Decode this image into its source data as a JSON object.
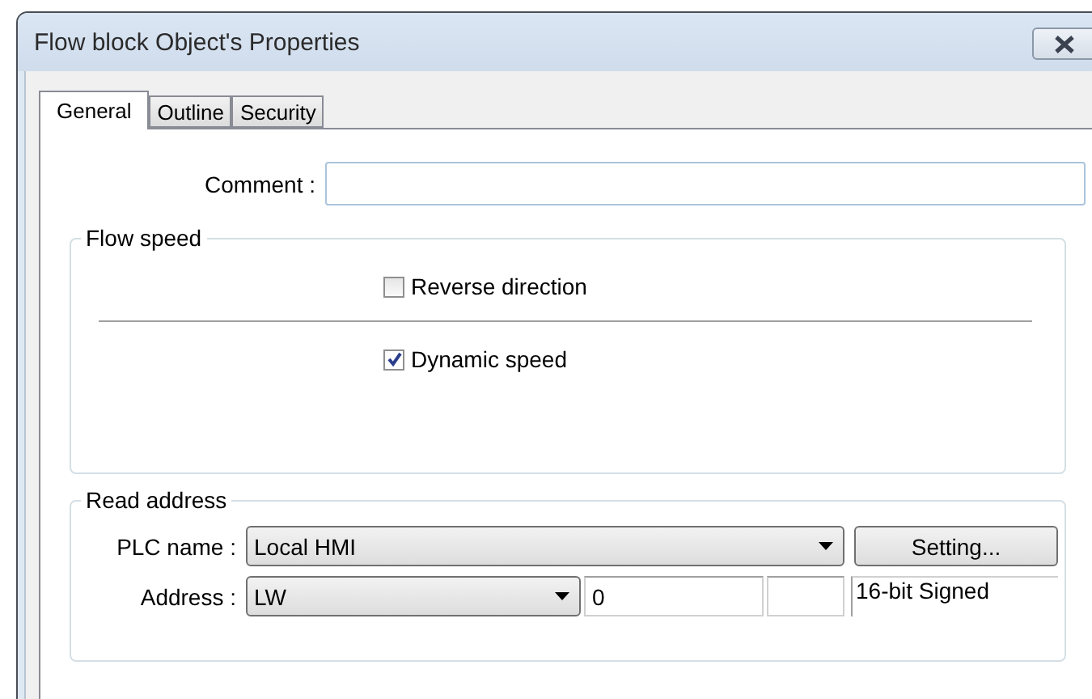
{
  "window": {
    "title": "Flow block Object's Properties"
  },
  "tabs": [
    {
      "label": "General",
      "selected": true
    },
    {
      "label": "Outline",
      "selected": false
    },
    {
      "label": "Security",
      "selected": false
    }
  ],
  "comment": {
    "label": "Comment :"
  },
  "flow_speed": {
    "title": "Flow speed",
    "reverse_direction": {
      "label": "Reverse direction",
      "checked": false
    },
    "dynamic_speed": {
      "label": "Dynamic speed",
      "checked": true
    }
  },
  "read_address": {
    "title": "Read address",
    "plc_name": {
      "label": "PLC name :",
      "value": "Local HMI"
    },
    "setting_button": "Setting...",
    "address": {
      "label": "Address :",
      "device": "LW",
      "value": "0",
      "type": "16-bit Signed"
    }
  }
}
